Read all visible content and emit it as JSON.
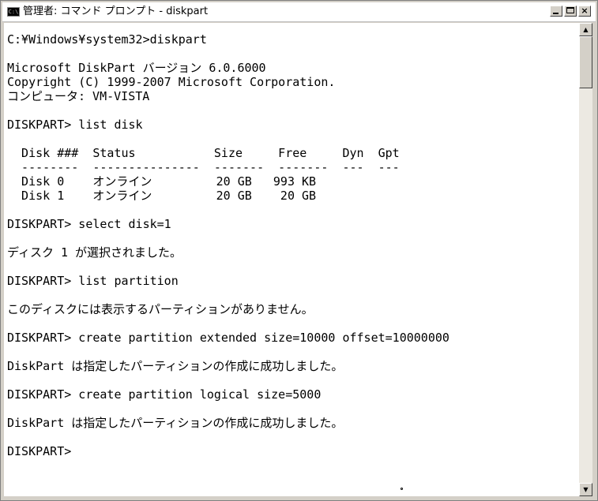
{
  "window": {
    "icon_text": "C:\\",
    "title": "管理者: コマンド プロンプト - diskpart",
    "minimize_label": "",
    "maximize_label": "",
    "close_label": "×"
  },
  "scrollbar": {
    "up_arrow": "▲",
    "down_arrow": "▼"
  },
  "console": {
    "lines": [
      "C:¥Windows¥system32>diskpart",
      "",
      "Microsoft DiskPart バージョン 6.0.6000",
      "Copyright (C) 1999-2007 Microsoft Corporation.",
      "コンピュータ: VM-VISTA",
      "",
      "DISKPART> list disk",
      "",
      "  Disk ###  Status           Size     Free     Dyn  Gpt",
      "  --------  ---------------  -------  -------  ---  ---",
      "  Disk 0    オンライン         20 GB   993 KB",
      "  Disk 1    オンライン         20 GB    20 GB",
      "",
      "DISKPART> select disk=1",
      "",
      "ディスク 1 が選択されました。",
      "",
      "DISKPART> list partition",
      "",
      "このディスクには表示するパーティションがありません。",
      "",
      "DISKPART> create partition extended size=10000 offset=10000000",
      "",
      "DiskPart は指定したパーティションの作成に成功しました。",
      "",
      "DISKPART> create partition logical size=5000",
      "",
      "DiskPart は指定したパーティションの作成に成功しました。",
      "",
      "DISKPART>"
    ]
  }
}
